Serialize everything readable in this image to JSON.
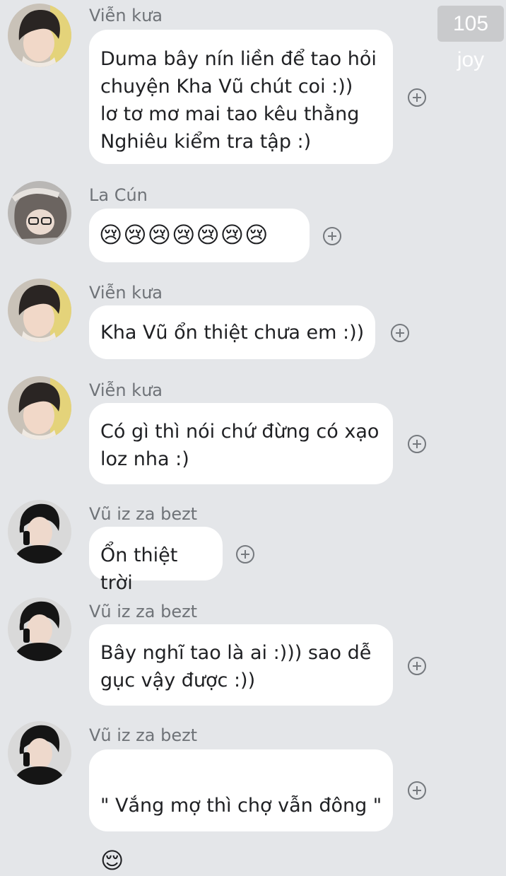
{
  "watermark": "105 joy",
  "messages": [
    {
      "sender": "Viễn kưa",
      "avatar": "avatar-vien-kua",
      "text": "Duma bây nín liền để tao hỏi\nchuyện Kha Vũ chút coi :))\nlơ tơ mơ mai tao kêu thằng\nNghiêu kiểm tra tập :)"
    },
    {
      "sender": "La Cún",
      "avatar": "avatar-la-cun",
      "text": "😢😢😢😢😢😢😢"
    },
    {
      "sender": "Viễn kưa",
      "avatar": "avatar-vien-kua",
      "text": "Kha Vũ ổn thiệt chưa em :))"
    },
    {
      "sender": "Viễn kưa",
      "avatar": "avatar-vien-kua",
      "text": "Có gì thì nói chứ đừng có xạo\nloz nha :)"
    },
    {
      "sender": "Vũ iz za bezt",
      "avatar": "avatar-vu",
      "text": "Ổn thiệt trời"
    },
    {
      "sender": "Vũ iz za bezt",
      "avatar": "avatar-vu",
      "text": "Bây nghĩ tao là ai :))) sao dễ\ngục vậy được :))"
    },
    {
      "sender": "Vũ iz za bezt",
      "avatar": "avatar-vu",
      "text": " \" Vắng mợ thì chợ vẫn đông \"",
      "emoji": "😌"
    }
  ],
  "icons": {
    "react": "add-reaction-icon"
  },
  "colors": {
    "background": "#e4e6e9",
    "bubble": "#ffffff",
    "sender": "#6f7378"
  }
}
